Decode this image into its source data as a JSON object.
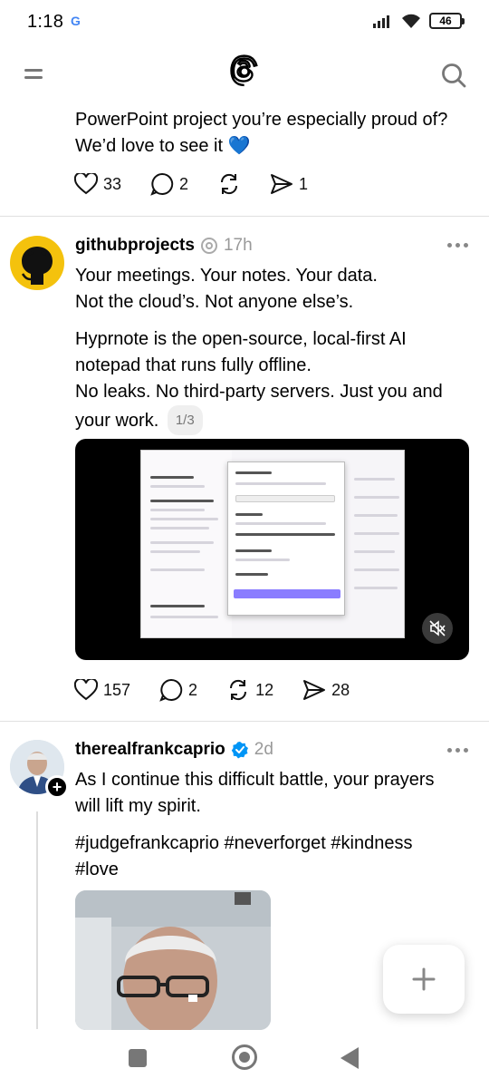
{
  "status_bar": {
    "time": "1:18",
    "google_badge": "G",
    "battery": "46"
  },
  "header": {
    "logo": "threads-logo-icon"
  },
  "post1": {
    "text_line1": "PowerPoint project you’re especially proud of?",
    "text_line2": "We’d love to see it",
    "emoji": "💙",
    "likes": "33",
    "replies": "2",
    "shares": "1"
  },
  "post2": {
    "author": "githubprojects",
    "time": "17h",
    "line1": "Your meetings. Your notes. Your data.",
    "line2": "Not the cloud’s. Not anyone else’s.",
    "para2_line1": "Hyprnote is the open-source, local-first AI",
    "para2_line2": "notepad that runs fully offline.",
    "para2_line3": "No leaks. No third-party servers. Just you and",
    "para2_line4": "your work.",
    "pager": "1/3",
    "likes": "157",
    "replies": "2",
    "reposts": "12",
    "shares": "28"
  },
  "post3": {
    "author": "therealfrankcaprio",
    "time": "2d",
    "line1": "As I continue this difficult battle, your prayers",
    "line2": "will lift my spirit.",
    "hashtags_line1": "#judgefrankcaprio #neverforget #kindness",
    "hashtags_line2": "#love"
  },
  "fab": {
    "label": "+"
  },
  "colors": {
    "accent_blue": "#0095f6",
    "battery_border": "#222222",
    "avatar2_bg": "#f4c20d"
  }
}
